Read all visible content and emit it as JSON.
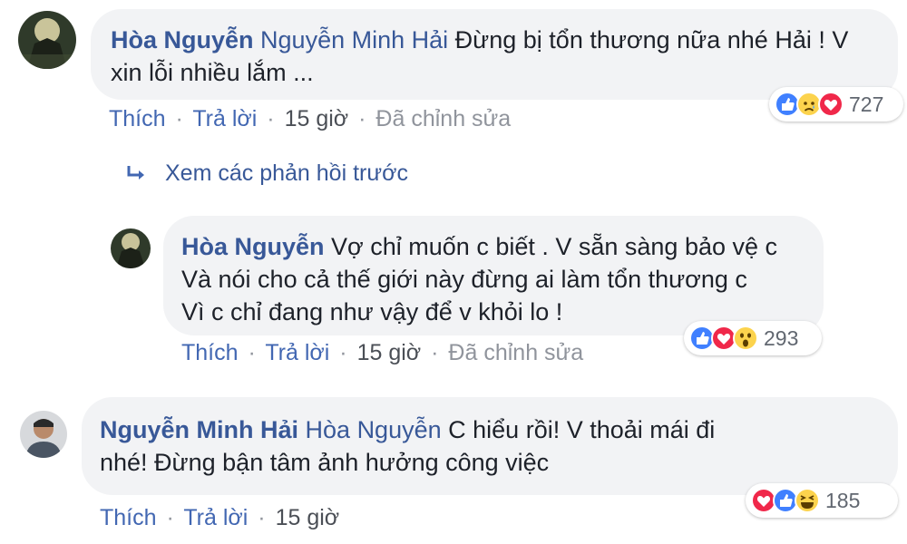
{
  "comments": [
    {
      "author": "Hòa Nguyễn",
      "mention": "Nguyễn Minh Hải",
      "lines": [
        "Đừng bị tổn thương nữa nhé Hải ! V",
        "xin lỗi nhiều lắm ..."
      ],
      "actions": {
        "like": "Thích",
        "reply": "Trả lời",
        "time": "15 giờ",
        "edited": "Đã chỉnh sửa",
        "sep": "·"
      },
      "reactions": {
        "icons": [
          "like-icon",
          "sad-icon",
          "love-icon"
        ],
        "count": "727"
      }
    },
    {
      "author": "Hòa Nguyễn",
      "mention": "",
      "lines": [
        "Vợ chỉ muốn c biết . V sẵn sàng bảo vệ c",
        "Và nói cho cả thế giới này đừng ai làm tổn thương c",
        "Vì c chỉ đang như vậy để v khỏi lo !"
      ],
      "actions": {
        "like": "Thích",
        "reply": "Trả lời",
        "time": "15 giờ",
        "edited": "Đã chỉnh sửa",
        "sep": "·"
      },
      "reactions": {
        "icons": [
          "like-icon",
          "love-icon",
          "wow-icon"
        ],
        "count": "293"
      }
    },
    {
      "author": "Nguyễn Minh Hải",
      "mention": "Hòa Nguyễn",
      "lines": [
        "C hiểu rồi! V thoải mái đi",
        "nhé! Đừng bận tâm ảnh hưởng công việc"
      ],
      "actions": {
        "like": "Thích",
        "reply": "Trả lời",
        "time": "15 giờ",
        "sep": "·"
      },
      "reactions": {
        "icons": [
          "love-icon",
          "like-icon",
          "haha-icon"
        ],
        "count": "185"
      }
    }
  ],
  "view_previous": "Xem các phản hồi trước",
  "colors": {
    "link": "#385898",
    "action": "#4267b2",
    "bubble": "#f2f3f5",
    "like": "#4080ff",
    "love": "#f0284a",
    "yellow": "#fcd34d"
  }
}
